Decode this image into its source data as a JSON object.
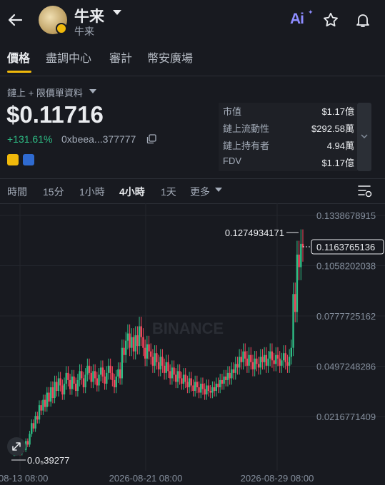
{
  "header": {
    "title": "牛来",
    "subtitle": "牛来",
    "ai_label": "Ai"
  },
  "tabs": [
    {
      "label": "價格",
      "active": true
    },
    {
      "label": "盡調中心",
      "active": false
    },
    {
      "label": "審計",
      "active": false
    },
    {
      "label": "幣安廣場",
      "active": false
    }
  ],
  "price_block": {
    "source_label": "鏈上 + 限價單資料",
    "price": "$0.11716",
    "change": "+131.61%",
    "address": "0xbeea...377777"
  },
  "stats": [
    {
      "label": "市值",
      "value": "$1.17億"
    },
    {
      "label": "鏈上流動性",
      "value": "$292.58萬"
    },
    {
      "label": "鏈上持有者",
      "value": "4.94萬"
    },
    {
      "label": "FDV",
      "value": "$1.17億"
    }
  ],
  "intervals": [
    {
      "label": "時間",
      "active": false
    },
    {
      "label": "15分",
      "active": false
    },
    {
      "label": "1小時",
      "active": false
    },
    {
      "label": "4小時",
      "active": true
    },
    {
      "label": "1天",
      "active": false
    },
    {
      "label": "更多",
      "active": false
    }
  ],
  "colors": {
    "background": "#181a20",
    "accent": "#f0b90b",
    "up": "#2ebd85",
    "down": "#f6465d",
    "ai": "#8d8cff"
  },
  "chart_data": {
    "type": "candlestick",
    "watermark": "BINANCE",
    "y_ticks": [
      "0.1338678915",
      "0.1058202038",
      "0.0777725162",
      "0.0497248286",
      "0.0216771409"
    ],
    "y_tick_values": [
      0.1338678915,
      0.1058202038,
      0.0777725162,
      0.0497248286,
      0.0216771409
    ],
    "x_ticks": [
      "08-13 08:00",
      "2026-08-21 08:00",
      "2026-08-29 08:00"
    ],
    "current_price_label": "0.1163765136",
    "current_price": 0.1163765136,
    "high_label": "0.1274934171",
    "low_label": "0.0₅39277",
    "low_value": 3.9277e-06,
    "candles_close": [
      0.0001,
      0.0002,
      0.0015,
      0.001,
      0.004,
      0.003,
      0.008,
      0.006,
      0.012,
      0.018,
      0.015,
      0.022,
      0.02,
      0.028,
      0.025,
      0.031,
      0.027,
      0.035,
      0.03,
      0.038,
      0.032,
      0.041,
      0.036,
      0.043,
      0.039,
      0.034,
      0.04,
      0.046,
      0.042,
      0.037,
      0.044,
      0.04,
      0.036,
      0.042,
      0.047,
      0.043,
      0.038,
      0.045,
      0.05,
      0.046,
      0.041,
      0.047,
      0.043,
      0.039,
      0.045,
      0.049,
      0.044,
      0.04,
      0.046,
      0.05,
      0.046,
      0.042,
      0.038,
      0.044,
      0.048,
      0.043,
      0.06,
      0.056,
      0.064,
      0.068,
      0.06,
      0.066,
      0.058,
      0.067,
      0.061,
      0.072,
      0.066,
      0.06,
      0.054,
      0.062,
      0.058,
      0.055,
      0.05,
      0.057,
      0.052,
      0.048,
      0.055,
      0.05,
      0.046,
      0.052,
      0.047,
      0.043,
      0.049,
      0.045,
      0.041,
      0.047,
      0.043,
      0.04,
      0.045,
      0.041,
      0.038,
      0.043,
      0.039,
      0.036,
      0.041,
      0.038,
      0.035,
      0.04,
      0.037,
      0.034,
      0.039,
      0.036,
      0.035,
      0.038,
      0.036,
      0.04,
      0.038,
      0.042,
      0.04,
      0.044,
      0.042,
      0.046,
      0.043,
      0.048,
      0.046,
      0.051,
      0.049,
      0.055,
      0.052,
      0.058,
      0.054,
      0.05,
      0.056,
      0.052,
      0.048,
      0.054,
      0.051,
      0.049,
      0.055,
      0.052,
      0.056,
      0.05,
      0.054,
      0.058,
      0.053,
      0.051,
      0.056,
      0.054,
      0.05,
      0.053,
      0.057,
      0.052,
      0.05,
      0.055,
      0.06,
      0.09,
      0.08,
      0.112,
      0.105,
      0.118,
      0.116
    ],
    "candles_open": [
      5e-05,
      0.0001,
      0.0002,
      0.0015,
      0.001,
      0.004,
      0.003,
      0.008,
      0.006,
      0.012,
      0.018,
      0.015,
      0.022,
      0.02,
      0.028,
      0.025,
      0.031,
      0.027,
      0.035,
      0.03,
      0.038,
      0.032,
      0.041,
      0.036,
      0.043,
      0.039,
      0.034,
      0.04,
      0.046,
      0.042,
      0.037,
      0.044,
      0.04,
      0.036,
      0.042,
      0.047,
      0.043,
      0.038,
      0.045,
      0.05,
      0.046,
      0.041,
      0.047,
      0.043,
      0.039,
      0.045,
      0.049,
      0.044,
      0.04,
      0.046,
      0.05,
      0.046,
      0.042,
      0.038,
      0.044,
      0.048,
      0.043,
      0.06,
      0.056,
      0.064,
      0.068,
      0.06,
      0.066,
      0.058,
      0.067,
      0.061,
      0.072,
      0.066,
      0.06,
      0.054,
      0.062,
      0.058,
      0.055,
      0.05,
      0.057,
      0.052,
      0.048,
      0.055,
      0.05,
      0.046,
      0.052,
      0.047,
      0.043,
      0.049,
      0.045,
      0.041,
      0.047,
      0.043,
      0.04,
      0.045,
      0.041,
      0.038,
      0.043,
      0.039,
      0.036,
      0.041,
      0.038,
      0.035,
      0.04,
      0.037,
      0.034,
      0.039,
      0.036,
      0.035,
      0.038,
      0.036,
      0.04,
      0.038,
      0.042,
      0.04,
      0.044,
      0.042,
      0.046,
      0.043,
      0.048,
      0.046,
      0.051,
      0.049,
      0.055,
      0.052,
      0.058,
      0.054,
      0.05,
      0.056,
      0.052,
      0.048,
      0.054,
      0.051,
      0.049,
      0.055,
      0.052,
      0.056,
      0.05,
      0.054,
      0.058,
      0.053,
      0.051,
      0.056,
      0.054,
      0.05,
      0.053,
      0.057,
      0.052,
      0.05,
      0.055,
      0.06,
      0.09,
      0.08,
      0.112,
      0.105,
      0.118
    ]
  }
}
